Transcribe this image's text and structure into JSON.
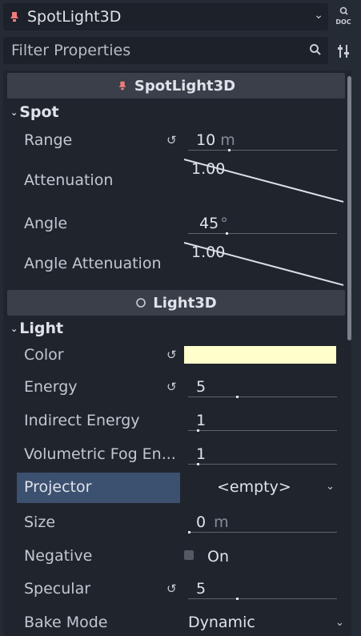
{
  "node_selector": {
    "title": "SpotLight3D"
  },
  "doc_button": {
    "label": "DOC"
  },
  "filter": {
    "placeholder": "Filter Properties"
  },
  "class_headers": [
    {
      "title": "SpotLight3D"
    },
    {
      "title": "Light3D"
    }
  ],
  "sections": {
    "spot": "Spot",
    "light": "Light"
  },
  "spot": {
    "range": {
      "label": "Range",
      "value": "10",
      "unit": "m",
      "slider": 0.27
    },
    "attenuation": {
      "label": "Attenuation",
      "value": "1.00"
    },
    "angle": {
      "label": "Angle",
      "value": "45",
      "unit": "°",
      "slider": 0.25
    },
    "angle_attenuation": {
      "label": "Angle Attenuation",
      "value": "1.00"
    }
  },
  "light": {
    "color": {
      "label": "Color",
      "value": "#ffffcc"
    },
    "energy": {
      "label": "Energy",
      "value": "5",
      "slider": 0.32
    },
    "indirect_energy": {
      "label": "Indirect Energy",
      "value": "1",
      "slider": 0.06
    },
    "volumetric_fog_energy": {
      "label": "Volumetric Fog En...",
      "value": "1",
      "slider": 0.06
    },
    "projector": {
      "label": "Projector",
      "value": "<empty>"
    },
    "size": {
      "label": "Size",
      "value": "0",
      "unit": "m",
      "slider": 0.0
    },
    "negative": {
      "label": "Negative",
      "value": "On"
    },
    "specular": {
      "label": "Specular",
      "value": "5",
      "slider": 0.32
    },
    "bake_mode": {
      "label": "Bake Mode",
      "value": "Dynamic"
    }
  },
  "colors": {
    "selected_row": "#3c5070",
    "light_color": "#ffffcc",
    "node_icon": "#f07c7c"
  }
}
